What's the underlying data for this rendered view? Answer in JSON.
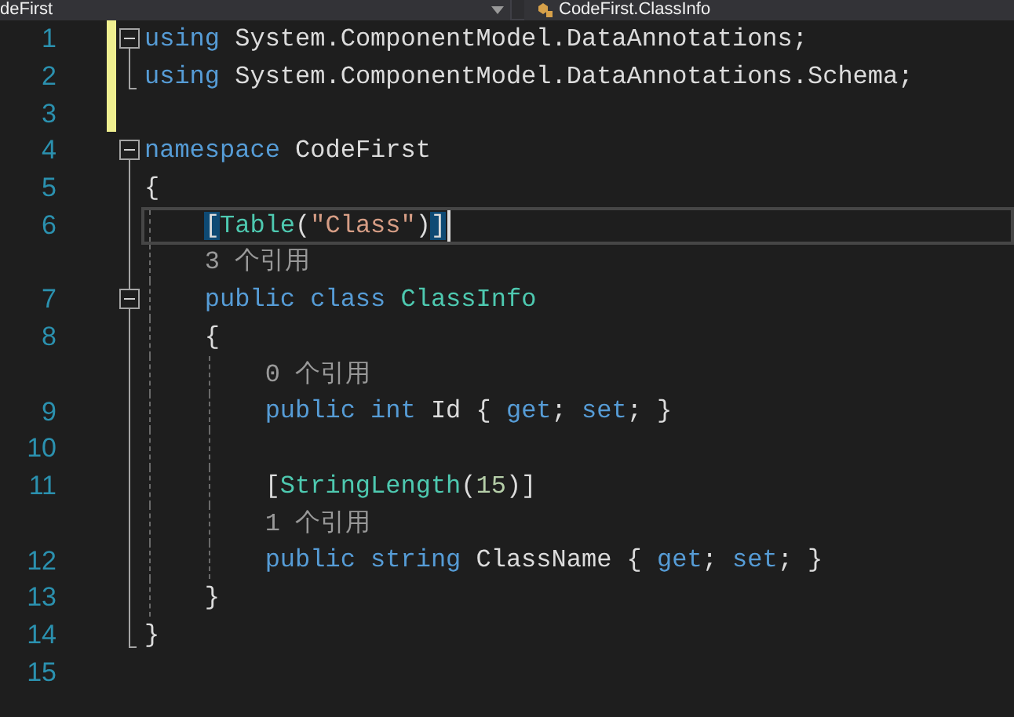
{
  "top_bar": {
    "type_dropdown": "deFirst",
    "member_dropdown": "CodeFirst.ClassInfo"
  },
  "lines": [
    {
      "kind": "code",
      "number": "1",
      "modified": true,
      "current": false,
      "expanded": true,
      "tokens": [
        {
          "text": "using",
          "kind": "keyword"
        },
        {
          "text": " System.ComponentModel.DataAnnotations;",
          "kind": "plain"
        }
      ],
      "children": [
        {
          "kind": "code",
          "number": "2",
          "modified": true,
          "current": false,
          "tokens": [
            {
              "text": "using",
              "kind": "keyword"
            },
            {
              "text": " System.ComponentModel.DataAnnotations.Schema;",
              "kind": "plain"
            }
          ]
        }
      ]
    },
    {
      "kind": "code",
      "number": "3",
      "modified": true,
      "current": false
    },
    {
      "kind": "code",
      "number": "4",
      "modified": false,
      "current": false,
      "expanded": true,
      "tokens": [
        {
          "text": "namespace",
          "kind": "keyword"
        },
        {
          "text": " CodeFirst",
          "kind": "plain"
        }
      ],
      "children": [
        {
          "kind": "code",
          "number": "5",
          "modified": false,
          "current": false,
          "tokens": [
            {
              "text": "{",
              "kind": "plain"
            }
          ]
        },
        {
          "kind": "code",
          "number": "6",
          "modified": false,
          "current": true,
          "tokens": [
            {
              "text": "    [",
              "kind": "plain",
              "matched": true
            },
            {
              "text": "Table",
              "kind": "type"
            },
            {
              "text": "(",
              "kind": "plain"
            },
            {
              "text": "\"Class\"",
              "kind": "string"
            },
            {
              "text": ")",
              "kind": "plain"
            },
            {
              "text": "]",
              "kind": "plain",
              "matched": true
            }
          ]
        },
        {
          "kind": "codelens",
          "text": "    3 个引用"
        },
        {
          "kind": "code",
          "number": "7",
          "modified": false,
          "current": false,
          "expanded": true,
          "tokens": [
            {
              "text": "    public",
              "kind": "keyword"
            },
            {
              "text": " class",
              "kind": "keyword"
            },
            {
              "text": " ClassInfo",
              "kind": "type"
            }
          ],
          "children": [
            {
              "kind": "code",
              "number": "8",
              "modified": false,
              "current": false,
              "tokens": [
                {
                  "text": "    {",
                  "kind": "plain"
                }
              ]
            },
            {
              "kind": "codelens",
              "text": "        0 个引用"
            },
            {
              "kind": "code",
              "number": "9",
              "modified": false,
              "current": false,
              "tokens": [
                {
                  "text": "        public",
                  "kind": "keyword"
                },
                {
                  "text": " int",
                  "kind": "keyword"
                },
                {
                  "text": " Id {",
                  "kind": "plain"
                },
                {
                  "text": " get",
                  "kind": "keyword"
                },
                {
                  "text": ";",
                  "kind": "plain"
                },
                {
                  "text": " set",
                  "kind": "keyword"
                },
                {
                  "text": "; }",
                  "kind": "plain"
                }
              ]
            },
            {
              "kind": "code",
              "number": "10",
              "modified": false,
              "current": false
            },
            {
              "kind": "code",
              "number": "11",
              "modified": false,
              "current": false,
              "tokens": [
                {
                  "text": "        [",
                  "kind": "plain"
                },
                {
                  "text": "StringLength",
                  "kind": "type"
                },
                {
                  "text": "(",
                  "kind": "plain"
                },
                {
                  "text": "15",
                  "kind": "number"
                },
                {
                  "text": ")]",
                  "kind": "plain"
                }
              ]
            },
            {
              "kind": "codelens",
              "text": "        1 个引用"
            },
            {
              "kind": "code",
              "number": "12",
              "modified": false,
              "current": false,
              "tokens": [
                {
                  "text": "        public",
                  "kind": "keyword"
                },
                {
                  "text": " string",
                  "kind": "keyword"
                },
                {
                  "text": " ClassName {",
                  "kind": "plain"
                },
                {
                  "text": " get",
                  "kind": "keyword"
                },
                {
                  "text": ";",
                  "kind": "plain"
                },
                {
                  "text": " set",
                  "kind": "keyword"
                },
                {
                  "text": "; }",
                  "kind": "plain"
                }
              ]
            },
            {
              "kind": "code",
              "number": "13",
              "modified": false,
              "current": false,
              "tokens": [
                {
                  "text": "    }",
                  "kind": "plain"
                }
              ]
            }
          ]
        },
        {
          "kind": "code",
          "number": "14",
          "modified": false,
          "current": false,
          "tokens": [
            {
              "text": "}",
              "kind": "plain"
            }
          ]
        }
      ]
    },
    {
      "kind": "code",
      "number": "15",
      "modified": false,
      "current": false
    }
  ]
}
